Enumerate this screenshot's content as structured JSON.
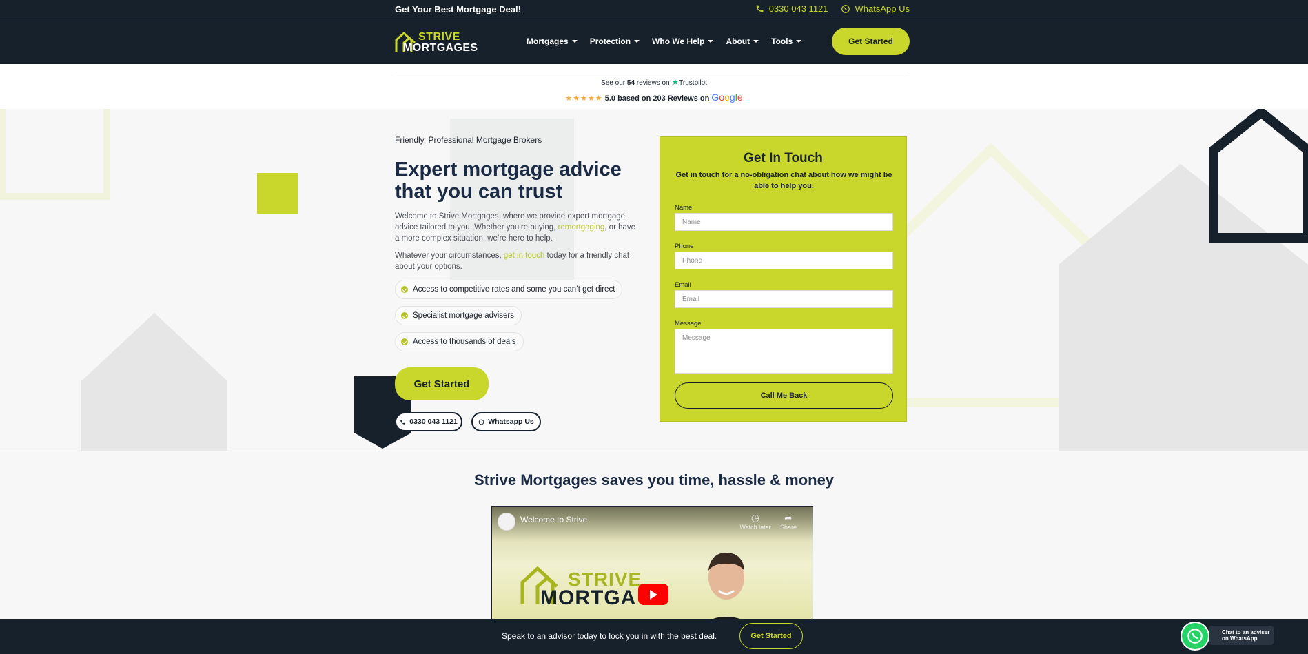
{
  "topbar": {
    "promo": "Get Your Best Mortgage Deal!",
    "phone": "0330 043 1121",
    "whatsapp": "WhatsApp Us"
  },
  "nav": {
    "logo_top": "STRIVE",
    "logo_bottom": "MORTGAGES",
    "items": [
      "Mortgages",
      "Protection",
      "Who We Help",
      "About",
      "Tools"
    ],
    "cta": "Get Started"
  },
  "reviews": {
    "trustpilot_prefix": "See our",
    "trustpilot_count": "54",
    "trustpilot_suffix": "reviews on",
    "trustpilot_brand": "Trustpilot",
    "google_rating": "5.0 based on 203 Reviews on",
    "google_brand": "Google",
    "stars": "★★★★★"
  },
  "hero": {
    "kicker": "Friendly, Professional Mortgage Brokers",
    "title": "Expert mortgage advice that you can trust",
    "p1_a": "Welcome to Strive Mortgages, where we provide expert mortgage advice tailored to you. Whether you’re buying, ",
    "p1_link": "remortgaging",
    "p1_b": ", or have a more complex situation, we’re here to help.",
    "p2_a": "Whatever your circumstances, ",
    "p2_link": "get in touch",
    "p2_b": " today for a friendly chat about your options.",
    "features": [
      "Access to competitive rates and some you can’t get direct",
      "Specialist mortgage advisers",
      "Access to thousands of deals"
    ],
    "cta": "Get Started",
    "phone_btn": "0330 043 1121",
    "whatsapp_btn": "Whatsapp Us"
  },
  "form": {
    "title": "Get In Touch",
    "subtitle": "Get in touch for a no-obligation chat about how we might be able to help you.",
    "name_label": "Name",
    "name_placeholder": "Name",
    "phone_label": "Phone",
    "phone_placeholder": "Phone",
    "email_label": "Email",
    "email_placeholder": "Email",
    "message_label": "Message",
    "message_placeholder": "Message",
    "submit": "Call Me Back"
  },
  "section2": {
    "title": "Strive Mortgages saves you time, hassle & money"
  },
  "video": {
    "title": "Welcome to Strive",
    "watch_later": "Watch later",
    "share": "Share",
    "brand_top": "STRIVE",
    "brand_bottom": "MORTGA  S"
  },
  "bottombar": {
    "message": "Speak to an advisor today to lock you in with the best deal.",
    "cta": "Get Started"
  },
  "whatsapp_float": {
    "line1": "Chat to an adviser",
    "line2": "on WhatsApp"
  },
  "colors": {
    "navy": "#17212b",
    "lime": "#c9d62b",
    "heading": "#1b2b45"
  }
}
